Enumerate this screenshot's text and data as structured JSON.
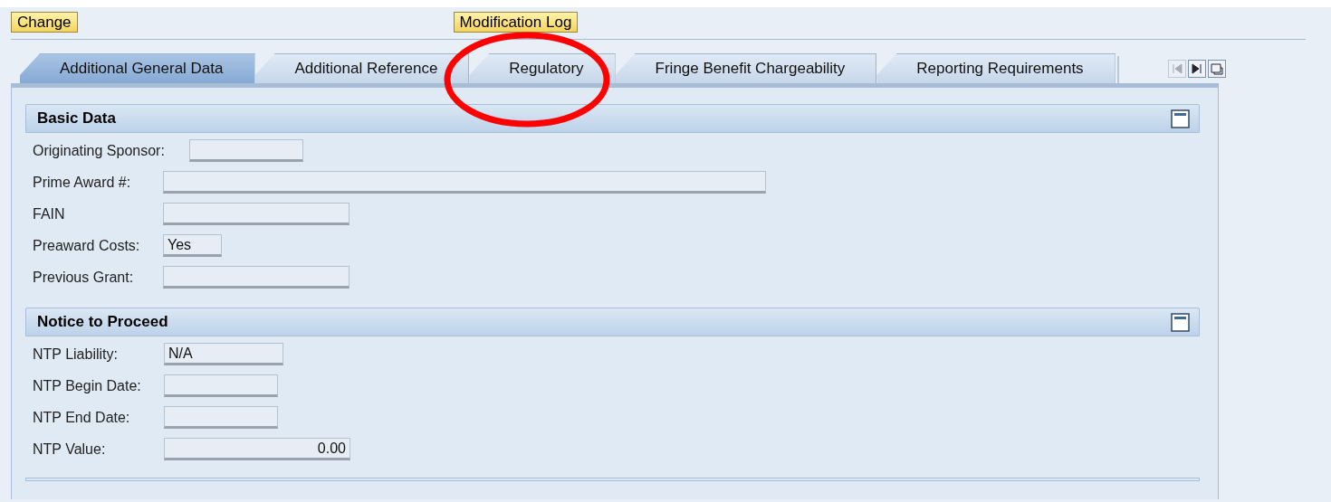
{
  "toolbar": {
    "buttons": [
      "Change",
      "Modification Log"
    ]
  },
  "tabs": [
    {
      "label": "Additional General Data",
      "selected": true
    },
    {
      "label": "Additional Reference",
      "selected": false
    },
    {
      "label": "Regulatory",
      "selected": false
    },
    {
      "label": "Fringe Benefit Chargeability",
      "selected": false
    },
    {
      "label": "Reporting Requirements",
      "selected": false
    }
  ],
  "tab_nav": {
    "first_disabled": true
  },
  "sections": [
    {
      "title": "Basic Data",
      "fields": [
        {
          "label": "Originating Sponsor:",
          "kind": "text"
        },
        {
          "label": "Prime Award #:",
          "kind": "text"
        },
        {
          "label": "FAIN",
          "kind": "text"
        },
        {
          "label": "Preaward Costs:",
          "value": "Yes",
          "kind": "text"
        },
        {
          "label": "Previous Grant:",
          "kind": "text"
        }
      ]
    },
    {
      "title": "Notice to Proceed",
      "fields": [
        {
          "label": "NTP Liability:",
          "value": "N/A",
          "kind": "text"
        },
        {
          "label": "NTP Begin Date:",
          "kind": "text"
        },
        {
          "label": "NTP End Date:",
          "kind": "text"
        },
        {
          "label": "NTP Value:",
          "value": "0.00",
          "kind": "amount"
        }
      ]
    }
  ],
  "annotation": {
    "color": "#ff0000"
  }
}
